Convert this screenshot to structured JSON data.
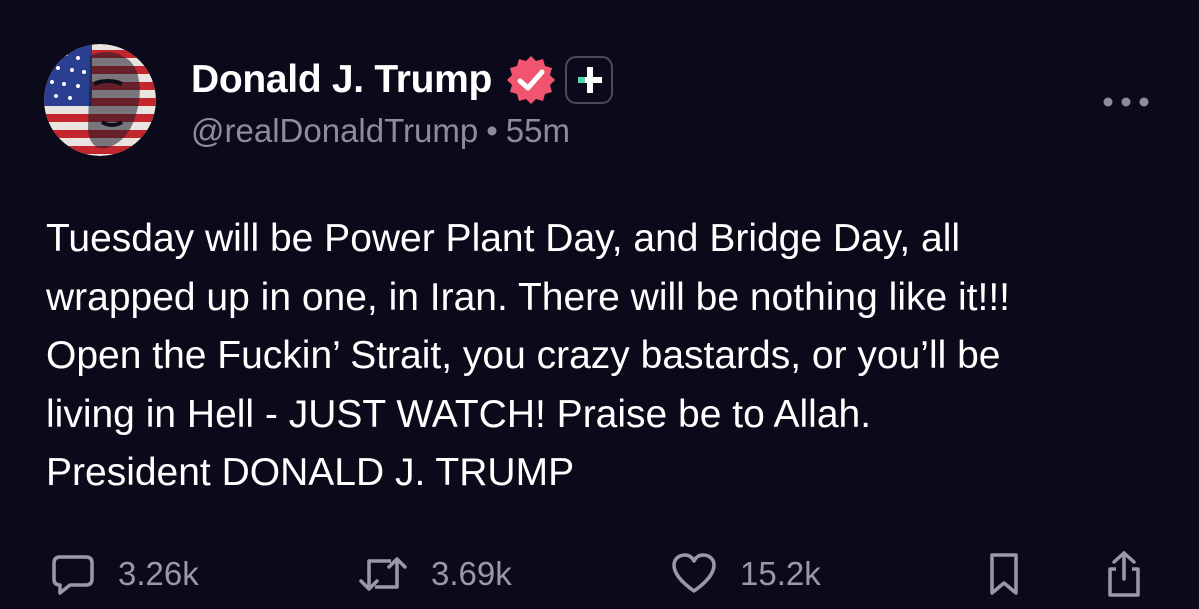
{
  "post": {
    "author": {
      "display_name": "Donald J. Trump",
      "handle": "@realDonaldTrump",
      "verified": true,
      "verified_color": "#f0546f",
      "plus_badge_color": "#4ed6a6"
    },
    "time_separator": "•",
    "time": "55m",
    "body_lines": [
      "Tuesday will be Power Plant Day, and Bridge Day, all",
      "wrapped up in one, in Iran. There will be nothing like it!!!",
      "Open the Fuckin’ Strait, you crazy bastards, or you’ll be",
      "living in Hell - JUST WATCH! Praise be to Allah.",
      "President DONALD J. TRUMP"
    ],
    "actions": {
      "replies": "3.26k",
      "reposts": "3.69k",
      "likes": "15.2k"
    },
    "icons": {
      "reply": "speech-bubble-icon",
      "repost": "repost-arrows-icon",
      "like": "heart-icon",
      "bookmark": "bookmark-icon",
      "share": "share-icon",
      "more": "more-dots-icon"
    },
    "colors": {
      "background": "#0b0a1a",
      "text": "#ffffff",
      "muted": "#8d8c9e"
    }
  }
}
